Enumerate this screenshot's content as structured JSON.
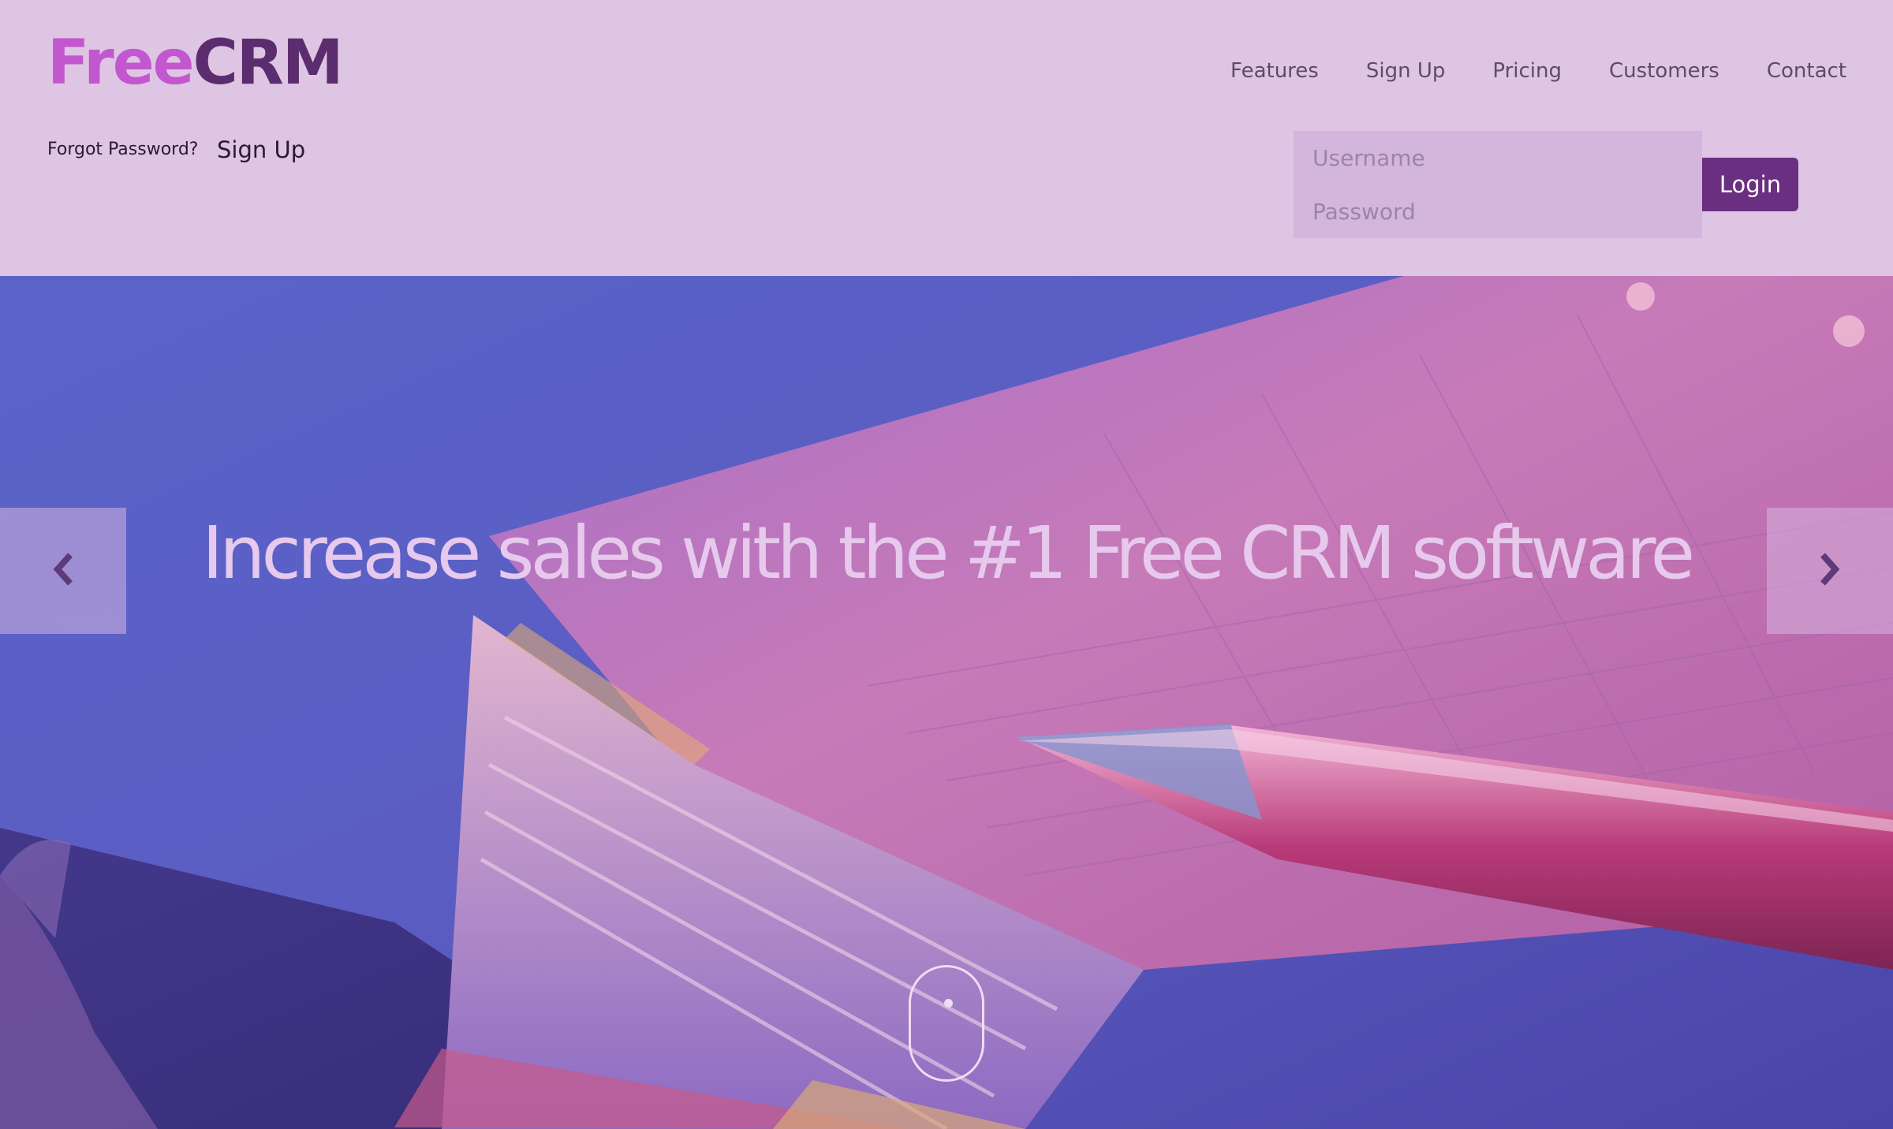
{
  "logo": {
    "part1": "Free",
    "part2": "CRM"
  },
  "nav": {
    "items": [
      {
        "label": "Features"
      },
      {
        "label": "Sign Up"
      },
      {
        "label": "Pricing"
      },
      {
        "label": "Customers"
      },
      {
        "label": "Contact"
      }
    ]
  },
  "header_links": {
    "forgot_password": "Forgot Password?",
    "sign_up": "Sign Up"
  },
  "login_form": {
    "username_placeholder": "Username",
    "username_value": "",
    "password_placeholder": "Password",
    "password_value": "",
    "login_button": "Login"
  },
  "hero": {
    "title": "Increase sales with the #1 Free CRM software",
    "prev_icon": "chevron-left-icon",
    "next_icon": "chevron-right-icon",
    "scroll_icon": "mouse-scroll-icon"
  },
  "colors": {
    "header_bg": "#dec5e3",
    "logo_free": "#c257cf",
    "logo_crm": "#5b2d6e",
    "login_button_bg": "#6a2f80",
    "login_fields_bg": "#d4b6dc",
    "hero_overlay": "#5c58c0",
    "hero_title": "#e6c9ec"
  }
}
